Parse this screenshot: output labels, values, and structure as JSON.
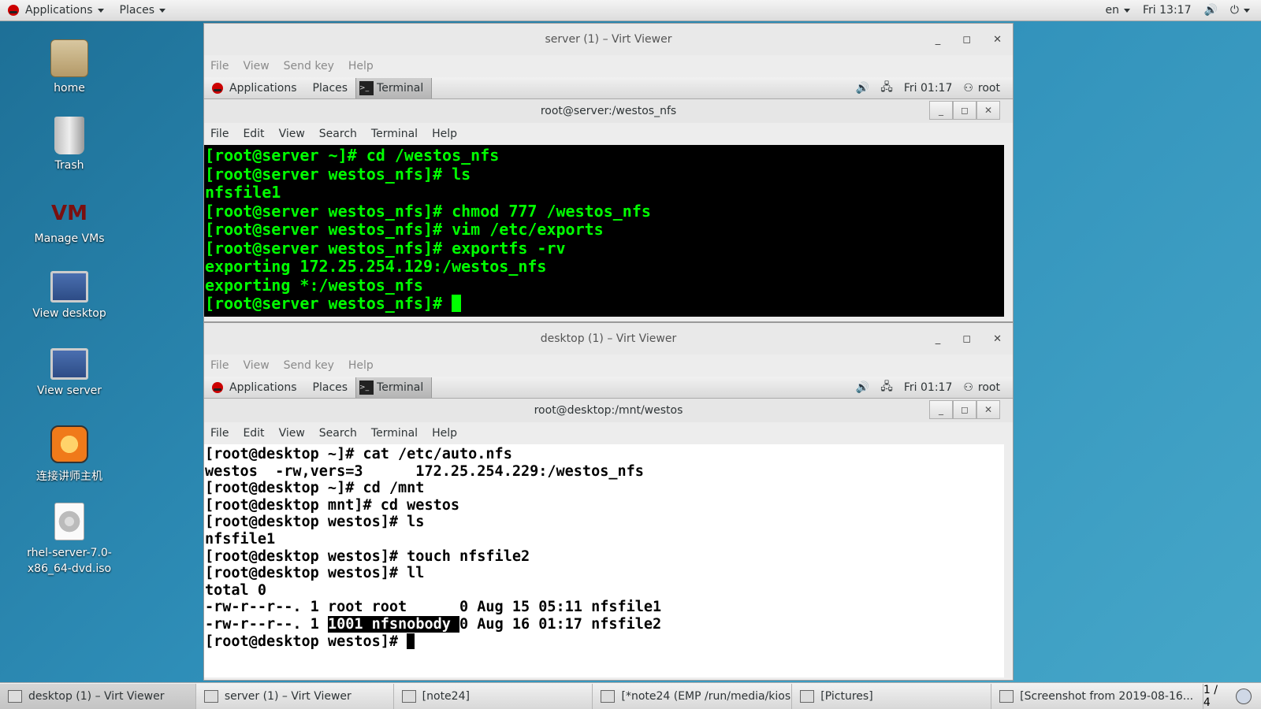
{
  "top_panel": {
    "applications": "Applications",
    "places": "Places",
    "language": "en",
    "clock": "Fri 13:17"
  },
  "desktop_icons": [
    {
      "label": "home",
      "icon": "home-folder-icon"
    },
    {
      "label": "Trash",
      "icon": "trash-icon"
    },
    {
      "label": "Manage VMs",
      "icon": "vmm-icon"
    },
    {
      "label": "View desktop",
      "icon": "monitor-icon"
    },
    {
      "label": "View server",
      "icon": "monitor-icon"
    },
    {
      "label": "连接讲师主机",
      "icon": "connect-app-icon"
    },
    {
      "label": "rhel-server-7.0-x86_64-dvd.iso",
      "icon": "disc-image-icon"
    }
  ],
  "server_viewer": {
    "title": "server (1) – Virt Viewer",
    "menu": [
      "File",
      "View",
      "Send key",
      "Help"
    ],
    "guest_panel": {
      "applications": "Applications",
      "places": "Places",
      "terminal": "Terminal",
      "clock": "Fri 01:17",
      "user": "root"
    },
    "terminal_title": "root@server:/westos_nfs",
    "terminal_menu": [
      "File",
      "Edit",
      "View",
      "Search",
      "Terminal",
      "Help"
    ],
    "lines": [
      "[root@server ~]# cd /westos_nfs",
      "[root@server westos_nfs]# ls",
      "nfsfile1",
      "[root@server westos_nfs]# chmod 777 /westos_nfs",
      "[root@server westos_nfs]# vim /etc/exports",
      "[root@server westos_nfs]# exportfs -rv",
      "exporting 172.25.254.129:/westos_nfs",
      "exporting *:/westos_nfs",
      "[root@server westos_nfs]# "
    ]
  },
  "desktop_viewer": {
    "title": "desktop (1) – Virt Viewer",
    "menu": [
      "File",
      "View",
      "Send key",
      "Help"
    ],
    "guest_panel": {
      "applications": "Applications",
      "places": "Places",
      "terminal": "Terminal",
      "clock": "Fri 01:17",
      "user": "root"
    },
    "terminal_title": "root@desktop:/mnt/westos",
    "terminal_menu": [
      "File",
      "Edit",
      "View",
      "Search",
      "Terminal",
      "Help"
    ],
    "lines": [
      "[root@desktop ~]# cat /etc/auto.nfs",
      "westos  -rw,vers=3      172.25.254.229:/westos_nfs",
      "[root@desktop ~]# cd /mnt",
      "[root@desktop mnt]# cd westos",
      "[root@desktop westos]# ls",
      "nfsfile1",
      "[root@desktop westos]# touch nfsfile2",
      "[root@desktop westos]# ll",
      "total 0",
      "-rw-r--r--. 1 root root      0 Aug 15 05:11 nfsfile1"
    ],
    "highlight_line": {
      "prefix": "-rw-r--r--. 1 ",
      "selected": "1001 nfsnobody ",
      "suffix": "0 Aug 16 01:17 nfsfile2"
    },
    "prompt": "[root@desktop westos]# "
  },
  "taskbar": [
    {
      "label": "desktop (1) – Virt Viewer",
      "active": true
    },
    {
      "label": "server (1) – Virt Viewer",
      "active": false
    },
    {
      "label": "[note24]",
      "active": false
    },
    {
      "label": "[*note24 (EMP /run/media/kiosk...",
      "active": false
    },
    {
      "label": "[Pictures]",
      "active": false
    },
    {
      "label": "[Screenshot from 2019-08-16...",
      "active": false
    }
  ],
  "workspace": "1 / 4"
}
